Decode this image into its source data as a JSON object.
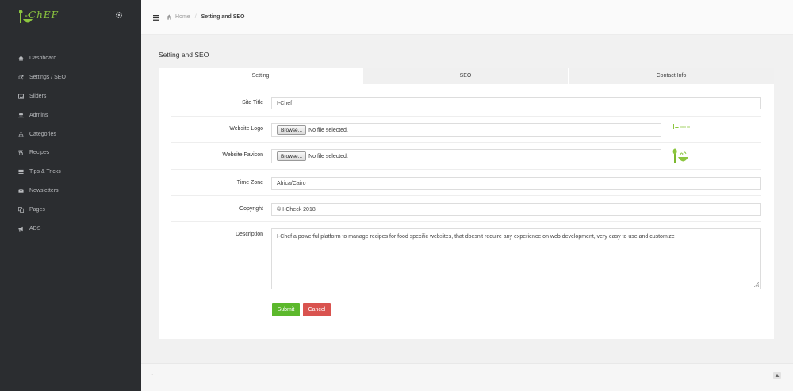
{
  "brand": {
    "logo_text": "ChEF",
    "accent": "#8cc63f"
  },
  "sidebar": {
    "items": [
      {
        "label": "Dashboard",
        "icon": "home-icon"
      },
      {
        "label": "Settings / SEO",
        "icon": "cogs-icon"
      },
      {
        "label": "Sliders",
        "icon": "image-icon"
      },
      {
        "label": "Admins",
        "icon": "users-icon"
      },
      {
        "label": "Categories",
        "icon": "sitemap-icon"
      },
      {
        "label": "Recipes",
        "icon": "cutlery-icon"
      },
      {
        "label": "Tips & Tricks",
        "icon": "list-icon"
      },
      {
        "label": "Newsletters",
        "icon": "envelope-icon"
      },
      {
        "label": "Pages",
        "icon": "copy-icon"
      },
      {
        "label": "ADS",
        "icon": "bullhorn-icon"
      }
    ]
  },
  "breadcrumb": {
    "home": "Home",
    "current": "Setting and SEO"
  },
  "page": {
    "title": "Setting and SEO"
  },
  "tabs": [
    {
      "label": "Setting",
      "active": true
    },
    {
      "label": "SEO",
      "active": false
    },
    {
      "label": "Contact Info",
      "active": false
    }
  ],
  "form": {
    "site_title": {
      "label": "Site Title",
      "value": "I-Chef"
    },
    "website_logo": {
      "label": "Website Logo",
      "button": "Browse...",
      "status": "No file selected."
    },
    "website_favicon": {
      "label": "Website Favicon",
      "button": "Browse...",
      "status": "No file selected."
    },
    "time_zone": {
      "label": "Time Zone",
      "value": "Africa/Cairo"
    },
    "copyright": {
      "label": "Copyright",
      "value": "© I-Check 2018"
    },
    "description": {
      "label": "Description",
      "value": "I-Chef a powerful platform to manage recipes for food specific websites, that doesn't require any experience on web development, very easy to use and customize"
    },
    "submit_label": "Submit",
    "cancel_label": "Cancel"
  },
  "footer": {
    "mark": "·"
  },
  "colors": {
    "sidebar_bg": "#2b2d30",
    "submit": "#5cb82c",
    "cancel": "#d9534f"
  }
}
